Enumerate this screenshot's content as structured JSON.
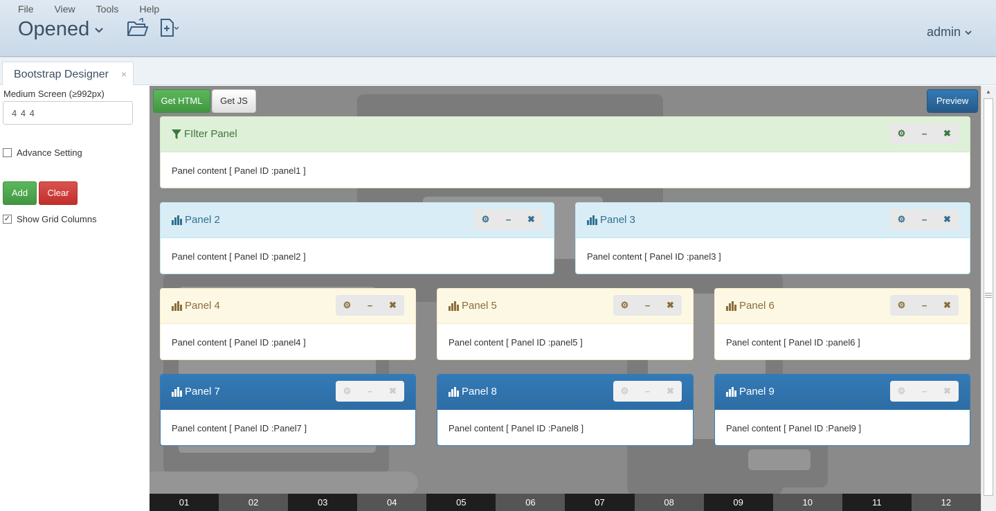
{
  "menu": [
    "File",
    "View",
    "Tools",
    "Help"
  ],
  "header": {
    "title": "Opened",
    "user": "admin"
  },
  "tab": {
    "label": "Bootstrap Designer",
    "close": "×"
  },
  "sidebar": {
    "screen_label": "Medium Screen (≥992px)",
    "columns_value": "4 4 4",
    "advance_setting": "Advance Setting",
    "add": "Add",
    "clear": "Clear",
    "show_grid": "Show Grid Columns",
    "show_grid_checked": true,
    "advance_checked": false
  },
  "canvas": {
    "get_html": "Get HTML",
    "get_js": "Get JS",
    "preview": "Preview"
  },
  "panels": [
    {
      "title": "FIlter Panel",
      "body": "Panel content [ Panel ID :panel1 ]",
      "style": "success",
      "icon": "filter-icon"
    },
    {
      "title": "Panel 2",
      "body": "Panel content [ Panel ID :panel2 ]",
      "style": "info",
      "icon": "bar-chart-icon"
    },
    {
      "title": "Panel 3",
      "body": "Panel content [ Panel ID :panel3 ]",
      "style": "info",
      "icon": "bar-chart-icon"
    },
    {
      "title": "Panel 4",
      "body": "Panel content [ Panel ID :panel4 ]",
      "style": "warning",
      "icon": "bar-chart-icon"
    },
    {
      "title": "Panel 5",
      "body": "Panel content [ Panel ID :panel5 ]",
      "style": "warning",
      "icon": "bar-chart-icon"
    },
    {
      "title": "Panel 6",
      "body": "Panel content [ Panel ID :panel6 ]",
      "style": "warning",
      "icon": "bar-chart-icon"
    },
    {
      "title": "Panel 7",
      "body": "Panel content [ Panel ID :Panel7 ]",
      "style": "primary",
      "icon": "bar-chart-icon"
    },
    {
      "title": "Panel 8",
      "body": "Panel content [ Panel ID :Panel8 ]",
      "style": "primary",
      "icon": "bar-chart-icon"
    },
    {
      "title": "Panel 9",
      "body": "Panel content [ Panel ID :Panel9 ]",
      "style": "primary",
      "icon": "bar-chart-icon"
    }
  ],
  "panel_tools": {
    "settings": "⚙",
    "minimize": "−",
    "close": "✖"
  },
  "grid_columns": [
    "01",
    "02",
    "03",
    "04",
    "05",
    "06",
    "07",
    "08",
    "09",
    "10",
    "11",
    "12"
  ]
}
